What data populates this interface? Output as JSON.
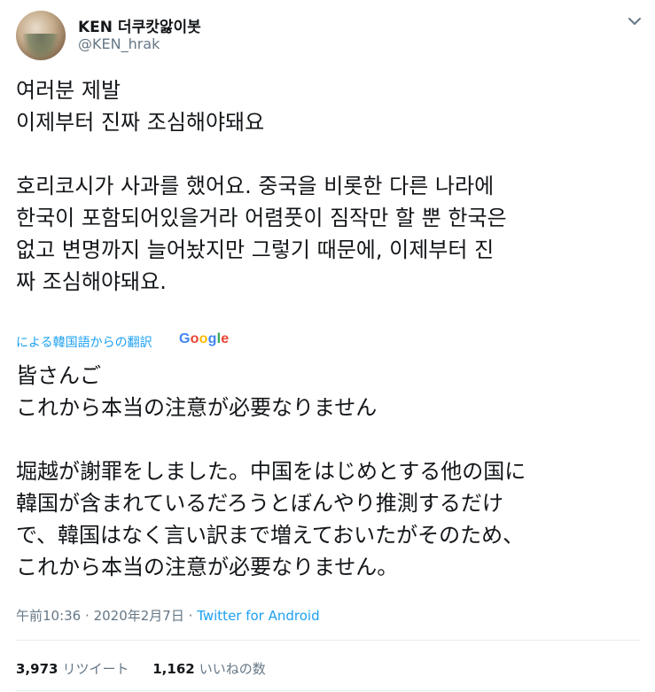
{
  "user": {
    "display_name": "KEN 더쿠캇앓이봇",
    "username": "@KEN_hrak"
  },
  "tweet": {
    "text": "여러분 제발\n이제부터 진짜 조심해야돼요\n\n호리코시가 사과를 했어요. 중국을 비롯한 다른 나라에\n한국이 포함되어있을거라 어렴풋이 짐작만 할 뿐 한국은\n없고 변명까지 늘어놨지만 그렇기 때문에, 이제부터 진\n짜 조심해야돼요."
  },
  "translation": {
    "label": "による韓国語からの翻訳",
    "provider": "Google",
    "text": "皆さんご\nこれから本当の注意が必要なりません\n\n堀越が謝罪をしました。中国をはじめとする他の国に\n韓国が含まれているだろうとぼんやり推測するだけ\nで、韓国はなく言い訳まで増えておいたがそのため、\nこれから本当の注意が必要なりません。"
  },
  "meta": {
    "time": "午前10:36",
    "separator": "·",
    "date": "2020年2月7日",
    "source": "Twitter for Android"
  },
  "stats": {
    "retweets_count": "3,973",
    "retweets_label": "リツイート",
    "likes_count": "1,162",
    "likes_label": "いいねの数"
  },
  "icons": {
    "caret": "chevron-down-icon",
    "avatar": "user-avatar"
  },
  "colors": {
    "link": "#1da1f2",
    "secondary_text": "#657786",
    "primary_text": "#14171a",
    "divider": "#e6ecf0"
  }
}
